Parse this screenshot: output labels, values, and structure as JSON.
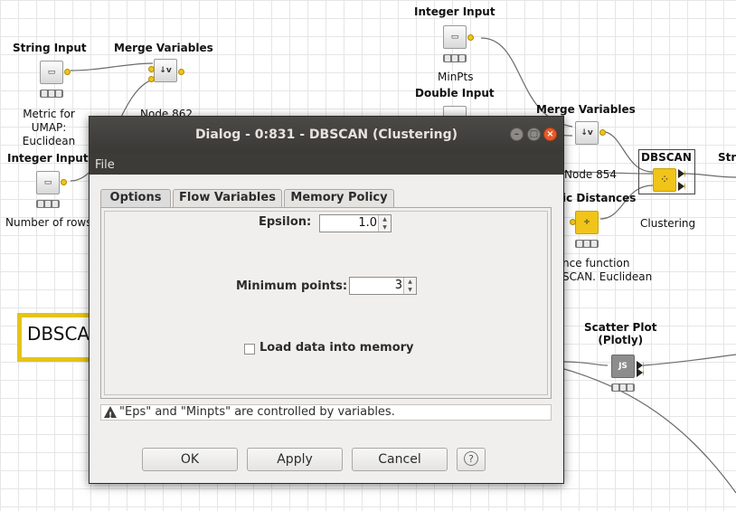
{
  "canvas": {
    "nodes": {
      "string_input": {
        "title": "String Input",
        "label": "Metric for UMAP:\nEuclidean"
      },
      "merge_variables_1": {
        "title": "Merge Variables",
        "label": "Node 862"
      },
      "integer_input_1": {
        "title": "Integer Input",
        "label": "Number of rows"
      },
      "integer_input_2": {
        "title": "Integer Input",
        "label": "MinPts"
      },
      "double_input": {
        "title": "Double Input",
        "label": ""
      },
      "merge_variables_2": {
        "title": "Merge Variables",
        "label": "Node 854"
      },
      "dbscan": {
        "title": "DBSCAN",
        "label": "Clustering"
      },
      "numeric_distances": {
        "title": "ic Distances",
        "label": "nce function\nSCAN. Euclidean"
      },
      "scatter_plot": {
        "title": "Scatter Plot\n(Plotly)",
        "label": ""
      },
      "partial_right": {
        "title": "Stri",
        "label": ""
      }
    },
    "annotation_text": "DBSCAN",
    "colors": {
      "node_yellow": "#f0c419",
      "annotation_border": "#e5c416",
      "dialog_title_bg": "#3c3b37",
      "close_button": "#e85a2a"
    }
  },
  "dialog": {
    "title": "Dialog - 0:831 - DBSCAN (Clustering)",
    "menu": [
      "File"
    ],
    "tabs": [
      {
        "label": "Options",
        "active": true
      },
      {
        "label": "Flow Variables",
        "active": false
      },
      {
        "label": "Memory Policy",
        "active": false
      }
    ],
    "fields": {
      "epsilon": {
        "label": "Epsilon:",
        "value": "1.0"
      },
      "min_points": {
        "label": "Minimum points:",
        "value": "3"
      },
      "load_memory": {
        "label": "Load data into memory",
        "checked": false
      }
    },
    "status_message": "\"Eps\" and \"Minpts\" are controlled by variables.",
    "buttons": {
      "ok": "OK",
      "apply": "Apply",
      "cancel": "Cancel",
      "help": "?"
    },
    "window_controls": {
      "minimize": "–",
      "maximize": "□",
      "close": "×"
    }
  }
}
